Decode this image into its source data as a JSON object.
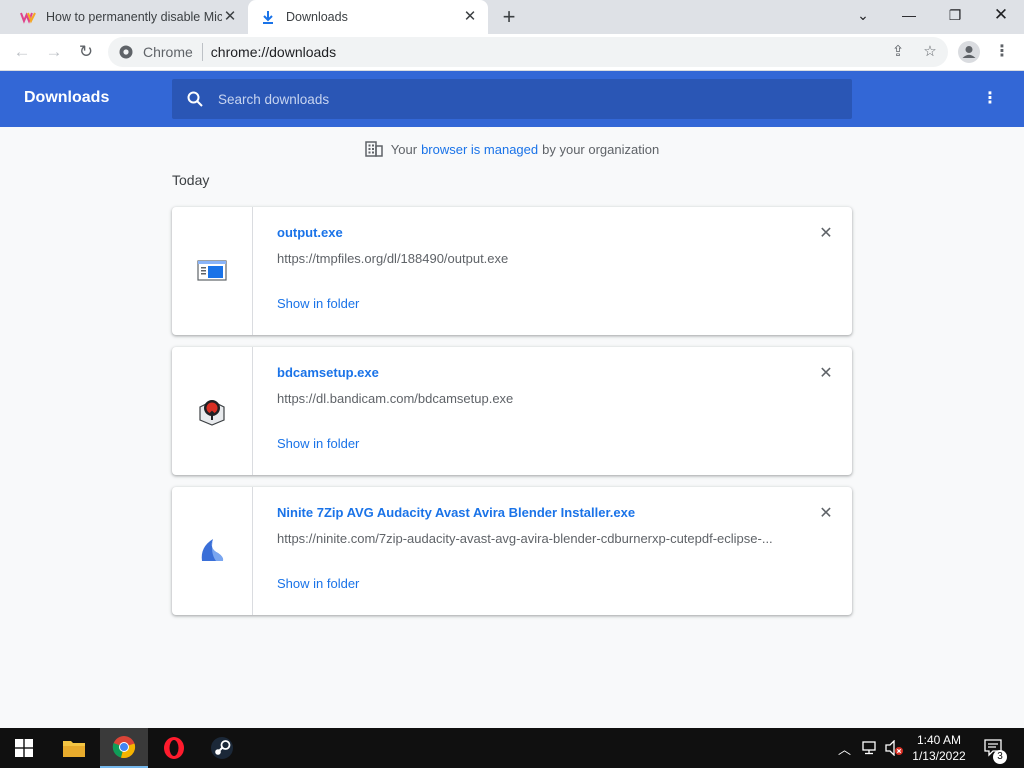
{
  "tabs": [
    {
      "title": "How to permanently disable Mic",
      "active": false,
      "favicon": "w-logo-icon"
    },
    {
      "title": "Downloads",
      "active": true,
      "favicon": "download-icon"
    }
  ],
  "omnibox": {
    "site_label": "Chrome",
    "url": "chrome://downloads"
  },
  "header": {
    "title": "Downloads",
    "search_placeholder": "Search downloads"
  },
  "managed_notice": {
    "prefix": "Your",
    "link": "browser is managed",
    "suffix": "by your organization"
  },
  "section_label": "Today",
  "downloads": [
    {
      "name": "output.exe",
      "url": "https://tmpfiles.org/dl/188490/output.exe",
      "action": "Show in folder",
      "icon": "window-app-icon"
    },
    {
      "name": "bdcamsetup.exe",
      "url": "https://dl.bandicam.com/bdcamsetup.exe",
      "action": "Show in folder",
      "icon": "bandicam-icon"
    },
    {
      "name": "Ninite 7Zip AVG Audacity Avast Avira Blender Installer.exe",
      "url": "https://ninite.com/7zip-audacity-avast-avg-avira-blender-cdburnerxp-cutepdf-eclipse-...",
      "action": "Show in folder",
      "icon": "ninite-icon"
    }
  ],
  "taskbar": {
    "time": "1:40 AM",
    "date": "1/13/2022",
    "notification_count": "3"
  },
  "colors": {
    "header_blue": "#3367d6",
    "link_blue": "#1a73e8"
  }
}
